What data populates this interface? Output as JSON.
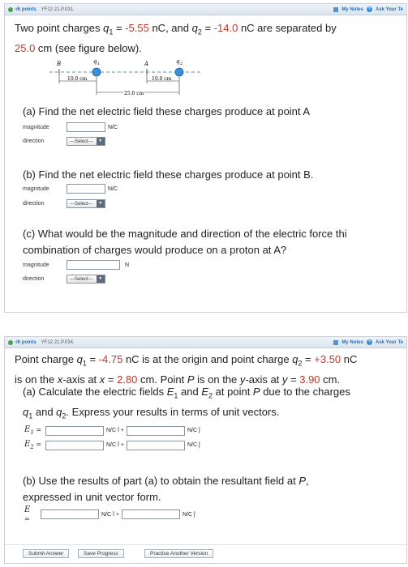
{
  "problem1": {
    "points": "-/6 points",
    "code": "YF12 21.P.031.",
    "my_notes": "My Notes",
    "ask": "Ask Your Te",
    "intro_a": "Two point charges ",
    "intro_q1": "q",
    "intro_sub1": "1",
    "intro_eq1": " = ",
    "q1_value": "-5.55",
    "intro_mid": " nC, and ",
    "intro_q2": "q",
    "intro_sub2": "2",
    "intro_eq2": " = ",
    "q2_value": "-14.0",
    "intro_end": " nC are separated by",
    "dist_value": "25.0",
    "intro_line2": " cm (see figure below).",
    "figure": {
      "label_B": "B",
      "label_q1": "q",
      "label_q1_sub": "1",
      "label_A": "A",
      "label_q2": "q",
      "label_q2_sub": "2",
      "dim1": "10.0 cm",
      "dim2": "10.0 cm",
      "dim3": "25.0 cm"
    },
    "part_a": "(a) Find the net electric field these charges produce at point A",
    "part_b": "(b) Find the net electric field these charges produce at point B.",
    "part_c1": "(c) What would be the magnitude and direction of the electric force thi",
    "part_c2": "combination of charges would produce on a proton at A?",
    "magnitude_label": "magnitude",
    "direction_label": "direction",
    "unit_nc": "N/C",
    "unit_n": "N",
    "select_label": "---Select---",
    "select_arrow": "▼"
  },
  "problem2": {
    "points": "-/6 points",
    "code": "YF12 21.P.034.",
    "my_notes": "My Notes",
    "ask": "Ask Your Te",
    "l1_a": "Point charge ",
    "l1_q1": "q",
    "l1_sub1": "1",
    "l1_eq": " = ",
    "q1_value": "-4.75",
    "l1_b": " nC is at the origin and point charge ",
    "l1_q2": "q",
    "l1_sub2": "2",
    "l1_eq2": " = ",
    "q2_value": "+3.50",
    "l1_c": " nC",
    "l2_a": "is on the ",
    "l2_x": "x",
    "l2_b": "-axis at ",
    "l2_x2": "x",
    "l2_eq": " = ",
    "x_value": "2.80",
    "l2_c": " cm. Point ",
    "l2_P": "P",
    "l2_d": " is on the ",
    "l2_y": "y",
    "l2_e": "-axis at ",
    "l2_y2": "y",
    "l2_eq2": " = ",
    "y_value": "3.90",
    "l2_f": " cm.",
    "pa_1": "(a) Calculate the electric fields ",
    "pa_e1": "E",
    "pa_s1": "1",
    "pa_and": " and ",
    "pa_e2": "E",
    "pa_s2": "2",
    "pa_2": " at point ",
    "pa_P": "P",
    "pa_3": " due to the charges",
    "pa_l2_q1": "q",
    "pa_l2_s1": "1",
    "pa_l2_and": " and ",
    "pa_l2_q2": "q",
    "pa_l2_s2": "2",
    "pa_l2_rest": ". Express your results in terms of unit vectors.",
    "e1_sym": "E",
    "e1_sub": "1",
    "e2_sym": "E",
    "e2_sub": "2",
    "e_sym": "E",
    "eq": " =",
    "unit_i": "N/C î +",
    "unit_j": "N/C ĵ",
    "pb_1": "(b) Use the results of part (a) to obtain the resultant field at ",
    "pb_P": "P",
    "pb_comma": ",",
    "pb_2": "expressed in unit vector form.",
    "submit": "Submit Answer",
    "save": "Save Progress",
    "practice": "Practice Another Version"
  },
  "colors": {
    "accent": "#2d6fb3",
    "value_red": "#c0392b",
    "charge": "#3b8fd9"
  }
}
